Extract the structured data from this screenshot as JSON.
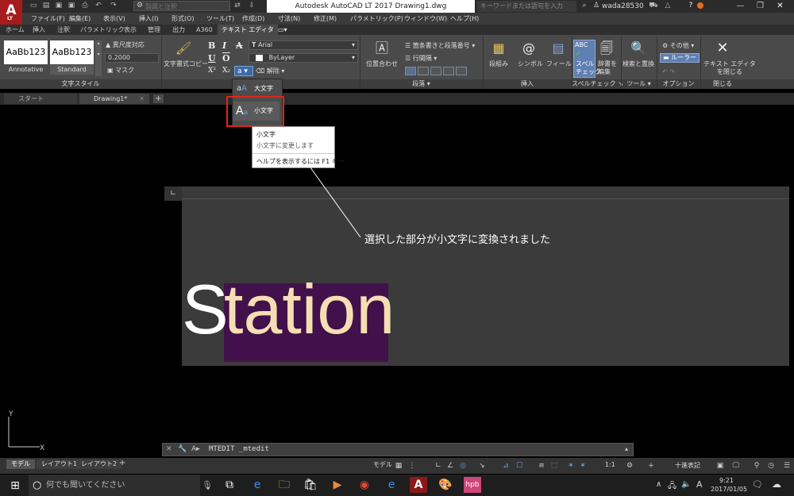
{
  "title_bar": {
    "app_logo": "A",
    "app_logo_sub": "LT",
    "workspace_placeholder": "製図と注釈",
    "document_title": "Autodesk AutoCAD LT 2017    Drawing1.dwg",
    "search_placeholder": "キーワードまたは語句を入力",
    "user_name": "wada28530"
  },
  "menu_bar": [
    "ファイル(F)",
    "編集(E)",
    "表示(V)",
    "挿入(I)",
    "形式(O)",
    "ツール(T)",
    "作成(D)",
    "寸法(N)",
    "修正(M)",
    "パラメトリック(P)",
    "ウィンドウ(W)",
    "ヘルプ(H)"
  ],
  "ribbon_tabs": [
    "ホーム",
    "挿入",
    "注釈",
    "パラメトリック",
    "表示",
    "管理",
    "出力",
    "A360",
    "テキスト エディタ"
  ],
  "ribbon": {
    "style_1": "AaBb123",
    "style_2": "AaBb123",
    "style_1_name": "Annotative",
    "style_2_name": "Standard",
    "aspect_label": "異尺度対応",
    "height_value": "0.2000",
    "mask_label": "マスク",
    "panel_text_style": "文字スタイル",
    "match_label": "文字書式コピー",
    "font_value": "Arial",
    "color_value": "ByLayer",
    "bold": "B",
    "italic": "I",
    "strike": "A",
    "underline": "U",
    "overline": "O",
    "superscript": "X²",
    "subscript": "X₂",
    "case_button": "a",
    "clear_label": "解除",
    "justify_label": "位置合わせ",
    "bullets_label": "箇条書きと段落番号",
    "line_spacing_label": "行間隔",
    "panel_paragraph": "段落",
    "columns_label": "段組み",
    "symbol_label": "シンボル",
    "field_label": "フィールド",
    "panel_insert": "挿入",
    "spell_label": "スペル\nチェック",
    "dict_label": "辞書を\n編集",
    "panel_spell": "スペルチェック",
    "find_label": "検索と置換",
    "panel_tools": "ツール",
    "other_label": "その他",
    "ruler_label": "ルーラー",
    "panel_options": "オプション",
    "close_label": "テキスト エディタ\nを閉じる",
    "panel_close": "閉じる"
  },
  "file_tabs": [
    "スタート",
    "Drawing1*"
  ],
  "case_menu": {
    "uppercase": "大文字",
    "lowercase": "小文字"
  },
  "tooltip": {
    "title": "小文字",
    "description": "小文字に変更します",
    "help": "ヘルプを表示するには F1 キー"
  },
  "callout": "選択した部分が小文字に変換されました",
  "mtext": {
    "unselected": "S",
    "selected": "tation"
  },
  "command_line": "MTEDIT _mtedit",
  "layout_tabs": [
    "モデル",
    "レイアウト1",
    "レイアウト2"
  ],
  "status": {
    "model": "モデル",
    "scale": "1:1",
    "units": "十進表記"
  },
  "taskbar": {
    "search_placeholder": "何でも聞いてください",
    "ime": "A",
    "time": "9:21",
    "date": "2017/01/05"
  },
  "colors": {
    "highlight": "#42104a",
    "selected_text": "#f5deb3",
    "callout_box": "#e0251b",
    "app_red": "#a61c1c"
  }
}
